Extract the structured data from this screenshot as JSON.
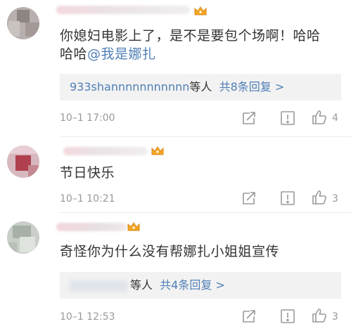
{
  "comments": [
    {
      "text_line1": "你媳妇电影上了，是不是要包个场啊！哈哈",
      "text_line2_prefix": "哈哈",
      "mention": "@我是娜扎",
      "reply_user": "933shannnnnnnnnnn",
      "reply_suffix": "等人",
      "reply_count": "共8条回复",
      "reply_arrow": ">",
      "time": "10–1 17:00",
      "likes": "4"
    },
    {
      "text_line1": "节日快乐",
      "time": "10–1 10:21",
      "likes": "3"
    },
    {
      "text_line1": "奇怪你为什么没有帮娜扎小姐姐宣传",
      "reply_suffix": "等人",
      "reply_count": "共4条回复",
      "reply_arrow": ">",
      "time": "10–1 12:53",
      "likes": "3"
    }
  ],
  "icons": {
    "badge": "crown-icon",
    "share": "share-icon",
    "report": "report-icon",
    "like": "like-icon"
  },
  "colors": {
    "link": "#4f7fb7",
    "meta": "#999999",
    "reply_bg": "#f2f2f2",
    "crown": "#f5a623"
  }
}
